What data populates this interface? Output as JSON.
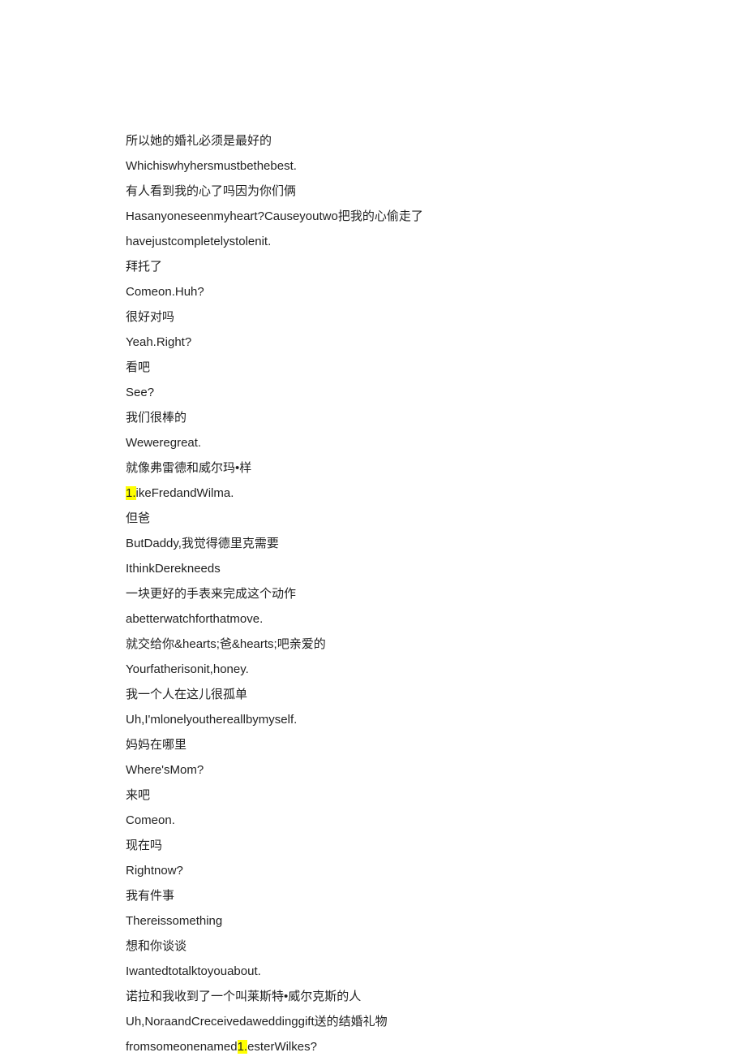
{
  "lines": [
    {
      "parts": [
        {
          "t": "所以她的婚礼必须是最好的"
        }
      ]
    },
    {
      "parts": [
        {
          "t": "Whichiswhyhersmustbethebest."
        }
      ]
    },
    {
      "parts": [
        {
          "t": "有人看到我的心了吗因为你们俩"
        }
      ]
    },
    {
      "parts": [
        {
          "t": "Hasanyoneseenmyheart?Causeyoutwo把我的心偷走了"
        }
      ]
    },
    {
      "parts": [
        {
          "t": "havejustcompletelystolenit."
        }
      ]
    },
    {
      "parts": [
        {
          "t": "拜托了"
        }
      ]
    },
    {
      "parts": [
        {
          "t": "Comeon.Huh?"
        }
      ]
    },
    {
      "parts": [
        {
          "t": "很好对吗"
        }
      ]
    },
    {
      "parts": [
        {
          "t": "Yeah.Right?"
        }
      ]
    },
    {
      "parts": [
        {
          "t": "看吧"
        }
      ]
    },
    {
      "parts": [
        {
          "t": "See?"
        }
      ]
    },
    {
      "parts": [
        {
          "t": "我们很棒的"
        }
      ]
    },
    {
      "parts": [
        {
          "t": "Weweregreat."
        }
      ]
    },
    {
      "parts": [
        {
          "t": "就像弗雷德和威尔玛•样"
        }
      ]
    },
    {
      "parts": [
        {
          "t": "1.",
          "hl": true
        },
        {
          "t": "ikeFredandWilma."
        }
      ]
    },
    {
      "parts": [
        {
          "t": "但爸"
        }
      ]
    },
    {
      "parts": [
        {
          "t": "ButDaddy,我觉得德里克需要"
        }
      ]
    },
    {
      "parts": [
        {
          "t": "IthinkDerekneeds"
        }
      ]
    },
    {
      "parts": [
        {
          "t": "一块更好的手表来完成这个动作"
        }
      ]
    },
    {
      "parts": [
        {
          "t": "abetterwatchforthatmove."
        }
      ]
    },
    {
      "parts": [
        {
          "t": "就交给你&hearts;爸&hearts;吧亲爱的"
        }
      ]
    },
    {
      "parts": [
        {
          "t": "Yourfatherisonit,honey."
        }
      ]
    },
    {
      "parts": [
        {
          "t": "我一个人在这儿很孤单"
        }
      ]
    },
    {
      "parts": [
        {
          "t": "Uh,I'mlonelyouthereallbymyself."
        }
      ]
    },
    {
      "parts": [
        {
          "t": "妈妈在哪里"
        }
      ]
    },
    {
      "parts": [
        {
          "t": "Where'sMom?"
        }
      ]
    },
    {
      "parts": [
        {
          "t": "来吧"
        }
      ]
    },
    {
      "parts": [
        {
          "t": "Comeon."
        }
      ]
    },
    {
      "parts": [
        {
          "t": "现在吗"
        }
      ]
    },
    {
      "parts": [
        {
          "t": "Rightnow?"
        }
      ]
    },
    {
      "parts": [
        {
          "t": "我有件事"
        }
      ]
    },
    {
      "parts": [
        {
          "t": "Thereissomething"
        }
      ]
    },
    {
      "parts": [
        {
          "t": "想和你谈谈"
        }
      ]
    },
    {
      "parts": [
        {
          "t": "Iwantedtotalktoyouabout."
        }
      ]
    },
    {
      "parts": [
        {
          "t": "诺拉和我收到了一个叫莱斯特•威尔克斯的人"
        }
      ]
    },
    {
      "parts": [
        {
          "t": "Uh,NoraandCreceivedaweddinggift送的结婚礼物"
        }
      ]
    },
    {
      "parts": [
        {
          "t": "fromsomeonenamed"
        },
        {
          "t": "1.",
          "hl": true
        },
        {
          "t": "esterWilkes?"
        }
      ]
    }
  ]
}
